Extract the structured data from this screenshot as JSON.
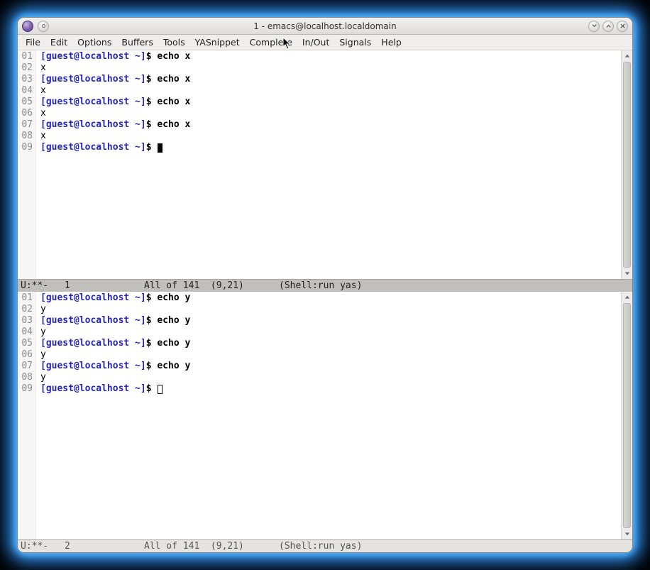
{
  "window": {
    "title": "1 - emacs@localhost.localdomain"
  },
  "menubar": {
    "items": [
      "File",
      "Edit",
      "Options",
      "Buffers",
      "Tools",
      "YASnippet",
      "Complete",
      "In/Out",
      "Signals",
      "Help"
    ]
  },
  "panes": [
    {
      "id": "top",
      "active": true,
      "lines": [
        {
          "n": "01",
          "type": "prompt",
          "prompt": "[guest@localhost ~]",
          "dollar": "$",
          "cmd": "echo x"
        },
        {
          "n": "02",
          "type": "output",
          "text": "x"
        },
        {
          "n": "03",
          "type": "prompt",
          "prompt": "[guest@localhost ~]",
          "dollar": "$",
          "cmd": "echo x"
        },
        {
          "n": "04",
          "type": "output",
          "text": "x"
        },
        {
          "n": "05",
          "type": "prompt",
          "prompt": "[guest@localhost ~]",
          "dollar": "$",
          "cmd": "echo x"
        },
        {
          "n": "06",
          "type": "output",
          "text": "x"
        },
        {
          "n": "07",
          "type": "prompt",
          "prompt": "[guest@localhost ~]",
          "dollar": "$",
          "cmd": "echo x"
        },
        {
          "n": "08",
          "type": "output",
          "text": "x"
        },
        {
          "n": "09",
          "type": "prompt",
          "prompt": "[guest@localhost ~]",
          "dollar": "$",
          "cmd": "",
          "cursor": "block"
        }
      ],
      "modeline": {
        "left": "U:**-",
        "buffer": "1",
        "position": "All of 141  (9,21)",
        "mode": "(Shell:run yas)"
      }
    },
    {
      "id": "bottom",
      "active": false,
      "lines": [
        {
          "n": "01",
          "type": "prompt",
          "prompt": "[guest@localhost ~]",
          "dollar": "$",
          "cmd": "echo y"
        },
        {
          "n": "02",
          "type": "output",
          "text": "y"
        },
        {
          "n": "03",
          "type": "prompt",
          "prompt": "[guest@localhost ~]",
          "dollar": "$",
          "cmd": "echo y"
        },
        {
          "n": "04",
          "type": "output",
          "text": "y"
        },
        {
          "n": "05",
          "type": "prompt",
          "prompt": "[guest@localhost ~]",
          "dollar": "$",
          "cmd": "echo y"
        },
        {
          "n": "06",
          "type": "output",
          "text": "y"
        },
        {
          "n": "07",
          "type": "prompt",
          "prompt": "[guest@localhost ~]",
          "dollar": "$",
          "cmd": "echo y"
        },
        {
          "n": "08",
          "type": "output",
          "text": "y"
        },
        {
          "n": "09",
          "type": "prompt",
          "prompt": "[guest@localhost ~]",
          "dollar": "$",
          "cmd": "",
          "cursor": "hollow"
        }
      ],
      "modeline": {
        "left": "U:**-",
        "buffer": "2",
        "position": "All of 141  (9,21)",
        "mode": "(Shell:run yas)"
      }
    }
  ]
}
